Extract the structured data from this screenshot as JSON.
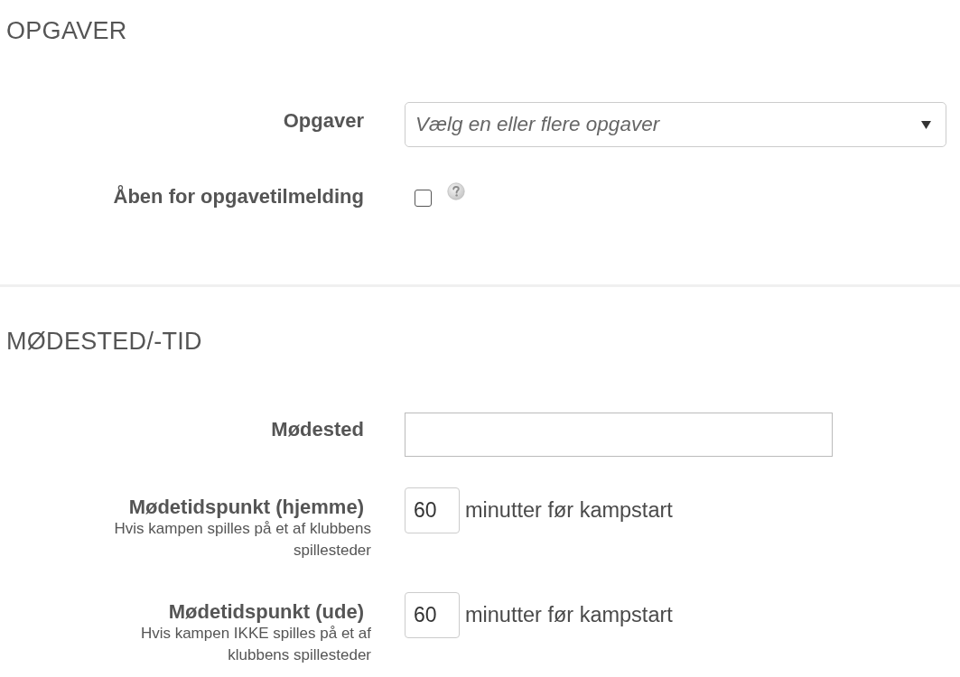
{
  "sections": [
    {
      "title": "OPGAVER",
      "fields": [
        {
          "kind": "select",
          "label": "Opgaver",
          "placeholder": "Vælg en eller flere opgaver"
        },
        {
          "kind": "checkbox",
          "label": "Åben for opgavetilmelding",
          "checked": false
        }
      ]
    },
    {
      "title": "MØDESTED/-TID",
      "fields": [
        {
          "kind": "text",
          "label": "Mødested"
        },
        {
          "kind": "minutes",
          "label": "Mødetidspunkt (hjemme)",
          "hint": "Hvis kampen spilles på et af klubbens spillesteder",
          "value": "60",
          "unit": "minutter før kampstart"
        },
        {
          "kind": "minutes",
          "label": "Mødetidspunkt (ude)",
          "hint": "Hvis kampen IKKE spilles på et af klubbens spillesteder",
          "value": "60",
          "unit": "minutter før kampstart"
        }
      ]
    }
  ]
}
